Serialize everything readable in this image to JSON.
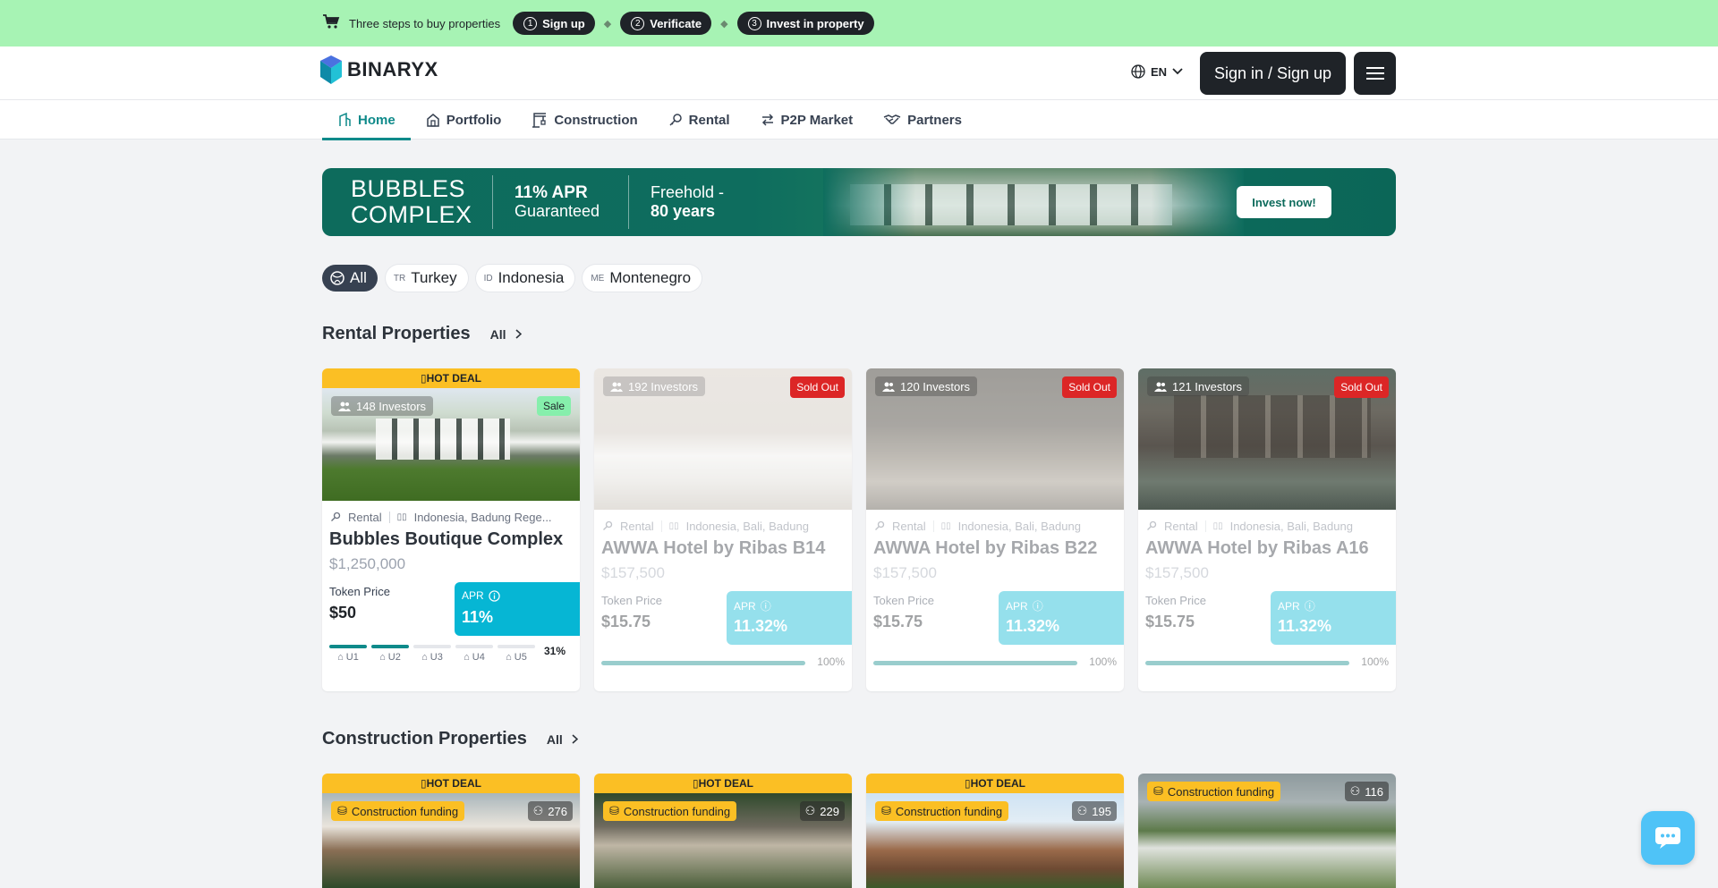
{
  "promo": {
    "text": "Three steps to buy properties",
    "steps": [
      {
        "num": "1",
        "label": "Sign up"
      },
      {
        "num": "2",
        "label": "Verificate"
      },
      {
        "num": "3",
        "label": "Invest in property"
      }
    ]
  },
  "header": {
    "logo": "BINARYX",
    "lang": "EN",
    "signin": "Sign in / Sign up"
  },
  "nav": [
    "Home",
    "Portfolio",
    "Construction",
    "Rental",
    "P2P Market",
    "Partners"
  ],
  "banner": {
    "title1": "BUBBLES",
    "title2": "COMPLEX",
    "apr1": "11% APR",
    "apr2": "Guaranteed",
    "free1": "Freehold -",
    "free2": "80 years",
    "cta": "Invest now!"
  },
  "filters": [
    {
      "flag": "",
      "label": "All"
    },
    {
      "flag": "TR",
      "label": "Turkey"
    },
    {
      "flag": "ID",
      "label": "Indonesia"
    },
    {
      "flag": "ME",
      "label": "Montenegro"
    }
  ],
  "rental": {
    "title": "Rental Properties",
    "all": "All",
    "cards": [
      {
        "hot": "HOT DEAL",
        "investors": "148  Investors",
        "tag": "Sale",
        "type": "Rental",
        "location": "Indonesia, Badung Rege...",
        "name": "Bubbles Boutique Complex",
        "price": "$1,250,000",
        "token_label": "Token Price",
        "token": "$50",
        "apr_label": "APR",
        "apr": "11%",
        "units": [
          "U1",
          "U2",
          "U3",
          "U4",
          "U5"
        ],
        "filled_units": 2,
        "percent": "31%"
      },
      {
        "investors": "192  Investors",
        "tag": "Sold Out",
        "type": "Rental",
        "location": "Indonesia, Bali, Badung",
        "name": "AWWA Hotel by Ribas B14",
        "price": "$157,500",
        "token_label": "Token Price",
        "token": "$15.75",
        "apr_label": "APR",
        "apr": "11.32%",
        "percent": "100%"
      },
      {
        "investors": "120  Investors",
        "tag": "Sold Out",
        "type": "Rental",
        "location": "Indonesia, Bali, Badung",
        "name": "AWWA Hotel by Ribas B22",
        "price": "$157,500",
        "token_label": "Token Price",
        "token": "$15.75",
        "apr_label": "APR",
        "apr": "11.32%",
        "percent": "100%"
      },
      {
        "investors": "121  Investors",
        "tag": "Sold Out",
        "type": "Rental",
        "location": "Indonesia, Bali, Badung",
        "name": "AWWA Hotel by Ribas A16",
        "price": "$157,500",
        "token_label": "Token Price",
        "token": "$15.75",
        "apr_label": "APR",
        "apr": "11.32%",
        "percent": "100%"
      }
    ]
  },
  "construction": {
    "title": "Construction Properties",
    "all": "All",
    "cards": [
      {
        "hot": "HOT DEAL",
        "badge": "Construction funding",
        "count": "276"
      },
      {
        "hot": "HOT DEAL",
        "badge": "Construction funding",
        "count": "229"
      },
      {
        "hot": "HOT DEAL",
        "badge": "Construction funding",
        "count": "195"
      },
      {
        "badge": "Construction funding",
        "count": "116"
      }
    ]
  }
}
